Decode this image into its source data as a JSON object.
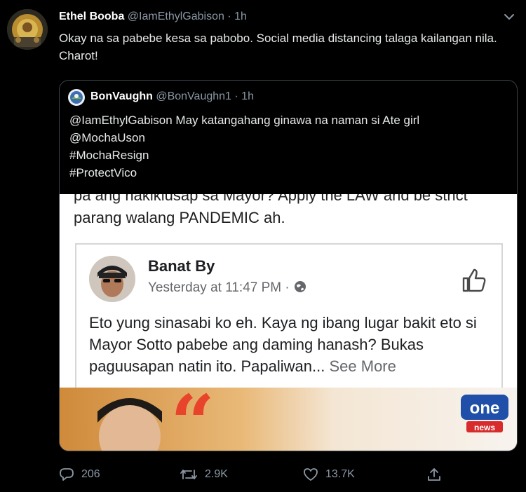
{
  "tweet": {
    "display_name": "Ethel Booba",
    "handle": "@IamEthylGabison",
    "separator": "·",
    "time": "1h",
    "text": "Okay na sa pabebe kesa sa pabobo. Social media distancing talaga kailangan nila. Charot!"
  },
  "quoted": {
    "display_name": "BonVaughn",
    "handle": "@BonVaughn1",
    "separator": "·",
    "time": "1h",
    "lines": [
      "@IamEthylGabison May katangahang ginawa na naman si Ate girl",
      "@MochaUson",
      "#MochaResign",
      "#ProtectVico"
    ]
  },
  "embedded_image": {
    "post_text": "pa ang nakikiusap sa Mayor? Apply the LAW and be strict parang walang PANDEMIC ah.",
    "fb_name": "Banat By",
    "fb_meta": "Yesterday at 11:47 PM ·",
    "fb_body": "Eto yung sinasabi ko eh. Kaya ng ibang lugar bakit eto si Mayor Sotto pabebe ang daming hanash? Bukas paguusapan natin ito. Papaliwan...",
    "see_more": "See More",
    "quote_marks": "“",
    "logo_top": "one",
    "logo_bottom": "news"
  },
  "actions": {
    "reply_count": "206",
    "retweet_count": "2.9K",
    "like_count": "13.7K"
  },
  "icons": [
    "caret-down-icon",
    "reply-icon",
    "retweet-icon",
    "like-icon",
    "share-icon",
    "globe-icon",
    "thumbs-up-icon"
  ],
  "colors": {
    "background": "#000000",
    "secondary_text": "#8b98a5",
    "border": "#3a4147",
    "quote_mark": "#e8432b",
    "logo_blue": "#1f4fa8",
    "logo_red": "#d82b2b"
  }
}
